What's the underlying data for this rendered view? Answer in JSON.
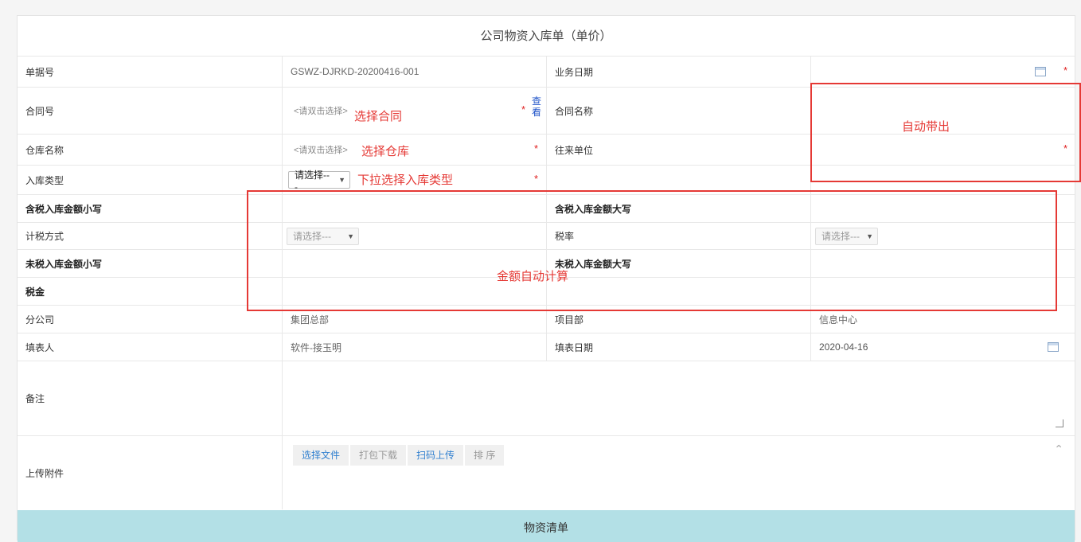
{
  "form": {
    "title": "公司物资入库单（单价）",
    "rows": {
      "doc_no": {
        "label": "单据号",
        "value": "GSWZ-DJRKD-20200416-001",
        "label2": "业务日期"
      },
      "contract": {
        "label": "合同号",
        "placeholder": "<请双击选择>",
        "link": "查看",
        "label2": "合同名称"
      },
      "warehouse": {
        "label": "仓库名称",
        "placeholder": "<请双击选择>",
        "label2": "往来单位"
      },
      "type": {
        "label": "入库类型",
        "select": "请选择---"
      },
      "tax_small": {
        "label": "含税入库金额小写",
        "label2": "含税入库金额大写"
      },
      "tax_method": {
        "label": "计税方式",
        "select": "请选择---",
        "label2": "税率",
        "select2": "请选择---"
      },
      "notax_small": {
        "label": "未税入库金额小写",
        "label2": "未税入库金额大写"
      },
      "tax": {
        "label": "税金"
      },
      "branch": {
        "label": "分公司",
        "value": "集团总部",
        "label2": "项目部",
        "value2": "信息中心"
      },
      "filler": {
        "label": "填表人",
        "value": "软件-接玉明",
        "label2": "填表日期",
        "value2": "2020-04-16"
      },
      "remark": {
        "label": "备注"
      },
      "upload": {
        "label": "上传附件",
        "buttons": [
          "选择文件",
          "打包下载",
          "扫码上传",
          "排 序"
        ]
      }
    },
    "required_mark": "*",
    "bottom_section": "物资清单"
  },
  "annotations": {
    "select_contract": "选择合同",
    "select_warehouse": "选择仓库",
    "select_type": "下拉选择入库类型",
    "auto_fill": "自动带出",
    "auto_calc": "金额自动计算"
  },
  "colors": {
    "annotation": "#e53935",
    "required": "#e02020",
    "link": "#2155c9",
    "section_bar": "#b3e0e6"
  }
}
